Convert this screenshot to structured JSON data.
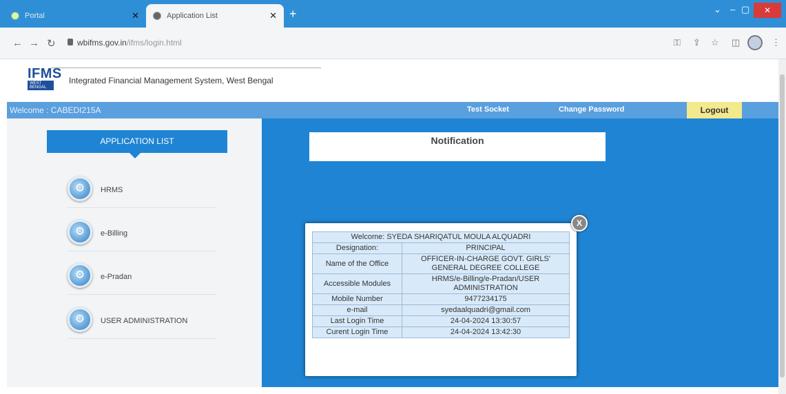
{
  "browser": {
    "tabs": [
      {
        "title": "Portal",
        "active": false
      },
      {
        "title": "Application List",
        "active": true
      }
    ],
    "url_host": "wbifms.gov.in",
    "url_path": "/ifms/login.html"
  },
  "header": {
    "logo_text": "IFMS",
    "logo_badge": "WEST BENGAL",
    "title": "Integrated Financial Management System, West Bengal"
  },
  "welcomebar": {
    "welcome": "Welcome : CABEDI215A",
    "test_socket": "Test Socket",
    "change_password": "Change Password",
    "logout": "Logout"
  },
  "sidebar": {
    "header": "APPLICATION LIST",
    "items": [
      {
        "label": "HRMS"
      },
      {
        "label": "e-Billing"
      },
      {
        "label": "e-Pradan"
      },
      {
        "label": "USER ADMINISTRATION"
      }
    ]
  },
  "notification": {
    "title": "Notification"
  },
  "popup": {
    "close": "X",
    "welcome_label": "Welcome:",
    "welcome_name": "SYEDA SHARIQATUL MOULA ALQUADRI",
    "rows": [
      {
        "label": "Designation:",
        "value": "PRINCIPAL"
      },
      {
        "label": "Name of the Office",
        "value": "OFFICER-IN-CHARGE GOVT. GIRLS' GENERAL DEGREE COLLEGE"
      },
      {
        "label": "Accessible Modules",
        "value": "HRMS/e-Billing/e-Pradan/USER ADMINISTRATION"
      },
      {
        "label": "Mobile Number",
        "value": "9477234175"
      },
      {
        "label": "e-mail",
        "value": "syedaalquadri@gmail.com"
      },
      {
        "label": "Last Login Time",
        "value": "24-04-2024 13:30:57"
      },
      {
        "label": "Curent Login Time",
        "value": "24-04-2024 13:42:30"
      }
    ]
  },
  "colors": {
    "accent": "#1f84d3",
    "welcome_bar": "#5a9fde",
    "logout_bg": "#f3e98d",
    "cell_bg": "#d8eaf9"
  }
}
